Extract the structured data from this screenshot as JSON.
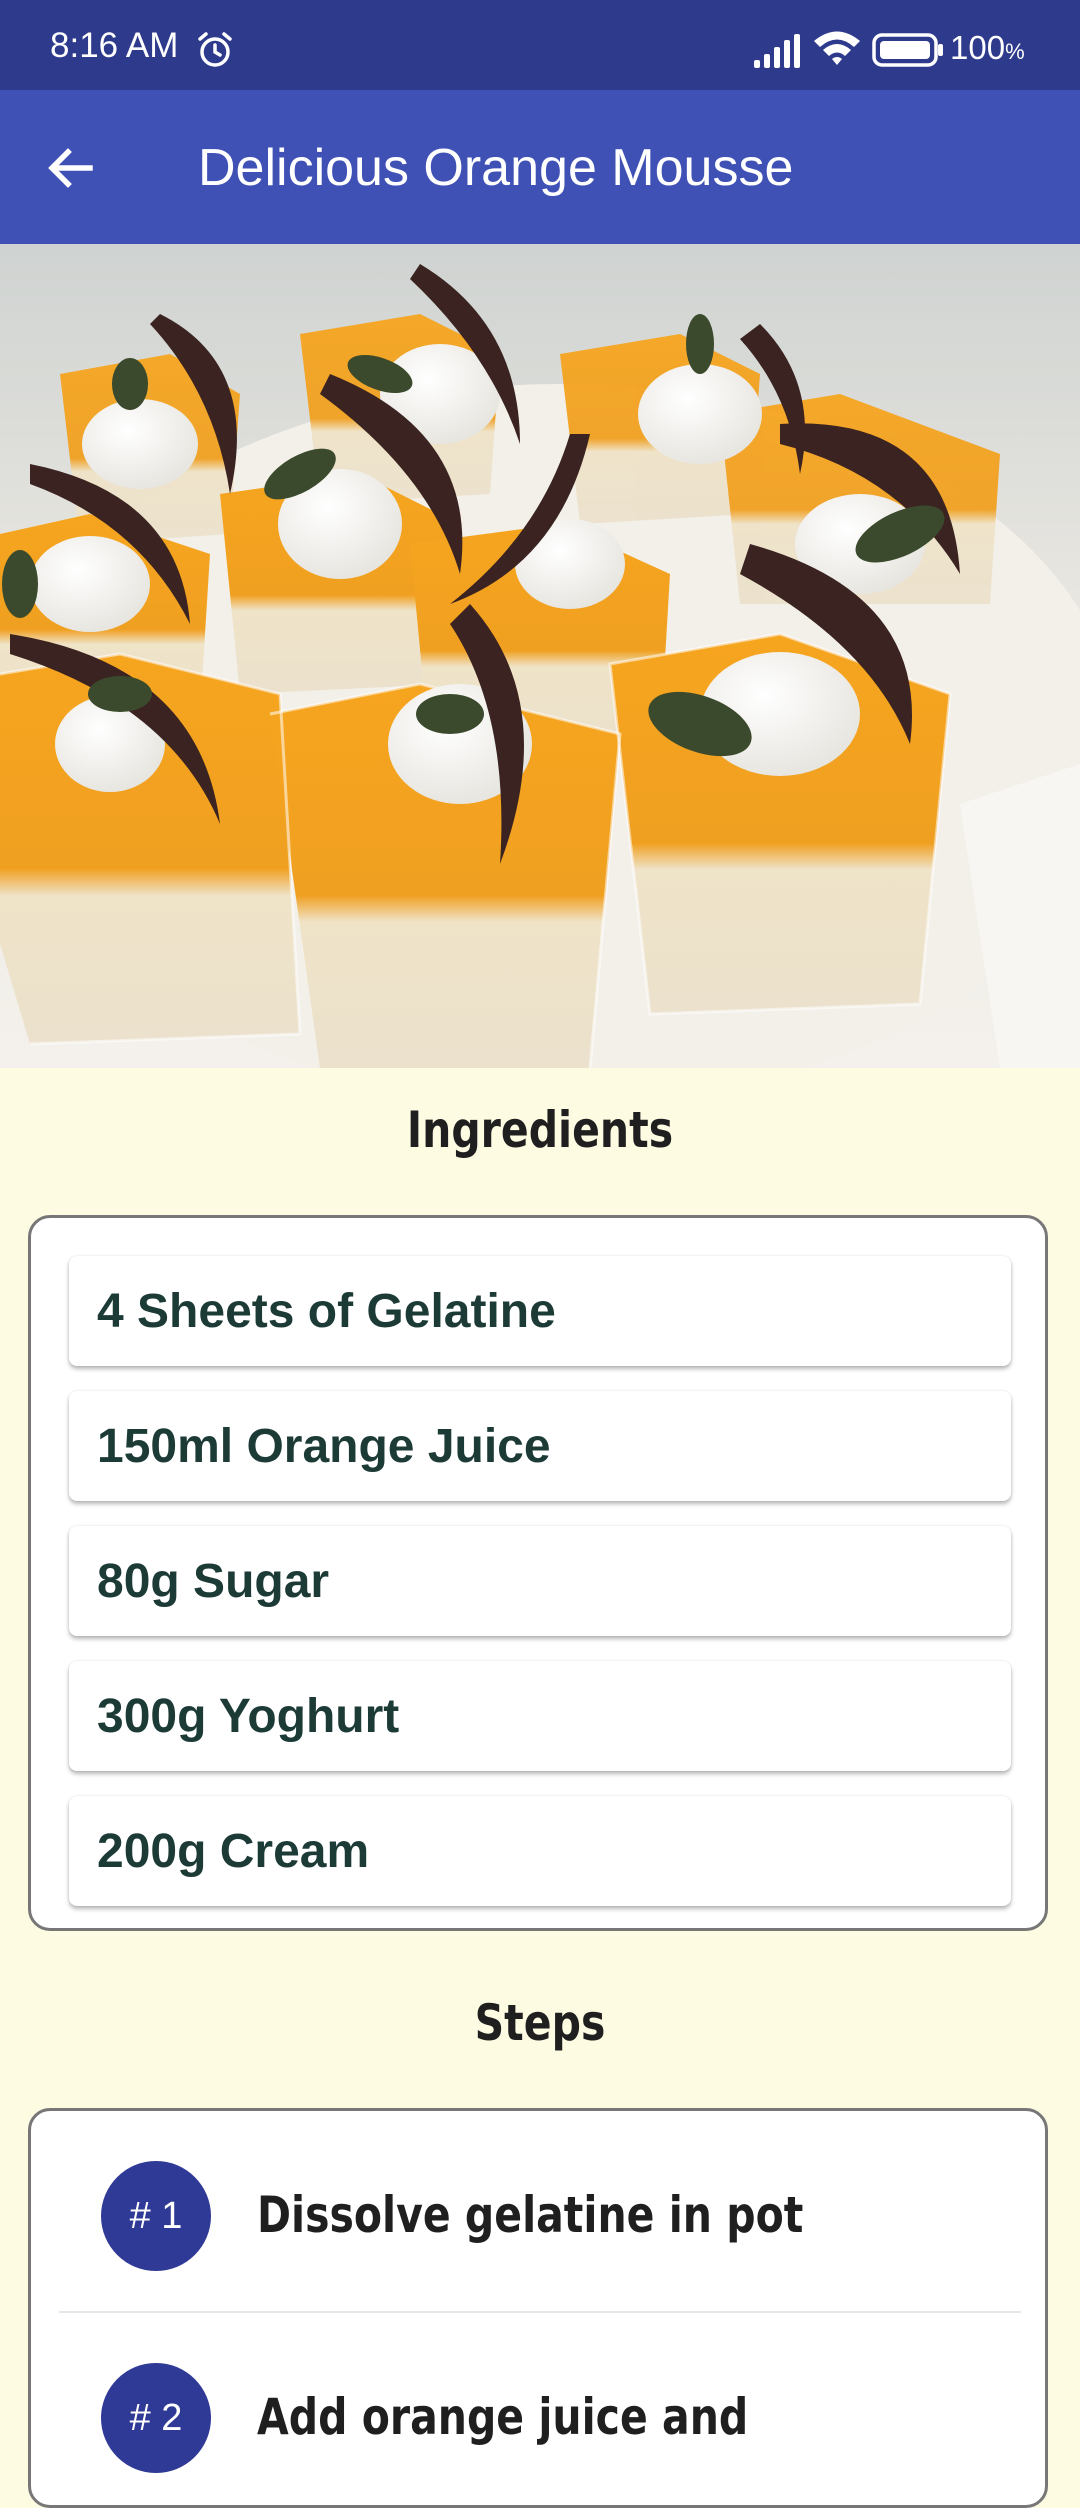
{
  "status_bar": {
    "time": "8:16 AM",
    "battery": "100",
    "battery_unit": "%"
  },
  "app_bar": {
    "title": "Delicious Orange Mousse"
  },
  "hero_image": {
    "description_icon": "photo"
  },
  "ingredients": {
    "heading": "Ingredients",
    "items": [
      "4 Sheets of Gelatine",
      "150ml Orange Juice",
      "80g Sugar",
      "300g Yoghurt",
      "200g Cream"
    ]
  },
  "steps": {
    "heading": "Steps",
    "items": [
      {
        "badge": "# 1",
        "text": "Dissolve gelatine in pot"
      },
      {
        "badge": "# 2",
        "text": "Add orange juice and"
      }
    ]
  },
  "colors": {
    "status_bar": "#2e3a8c",
    "app_bar": "#3f51b5",
    "background": "#fefbe3",
    "badge": "#2f3a96",
    "ingredient_text": "#1d3b36"
  }
}
